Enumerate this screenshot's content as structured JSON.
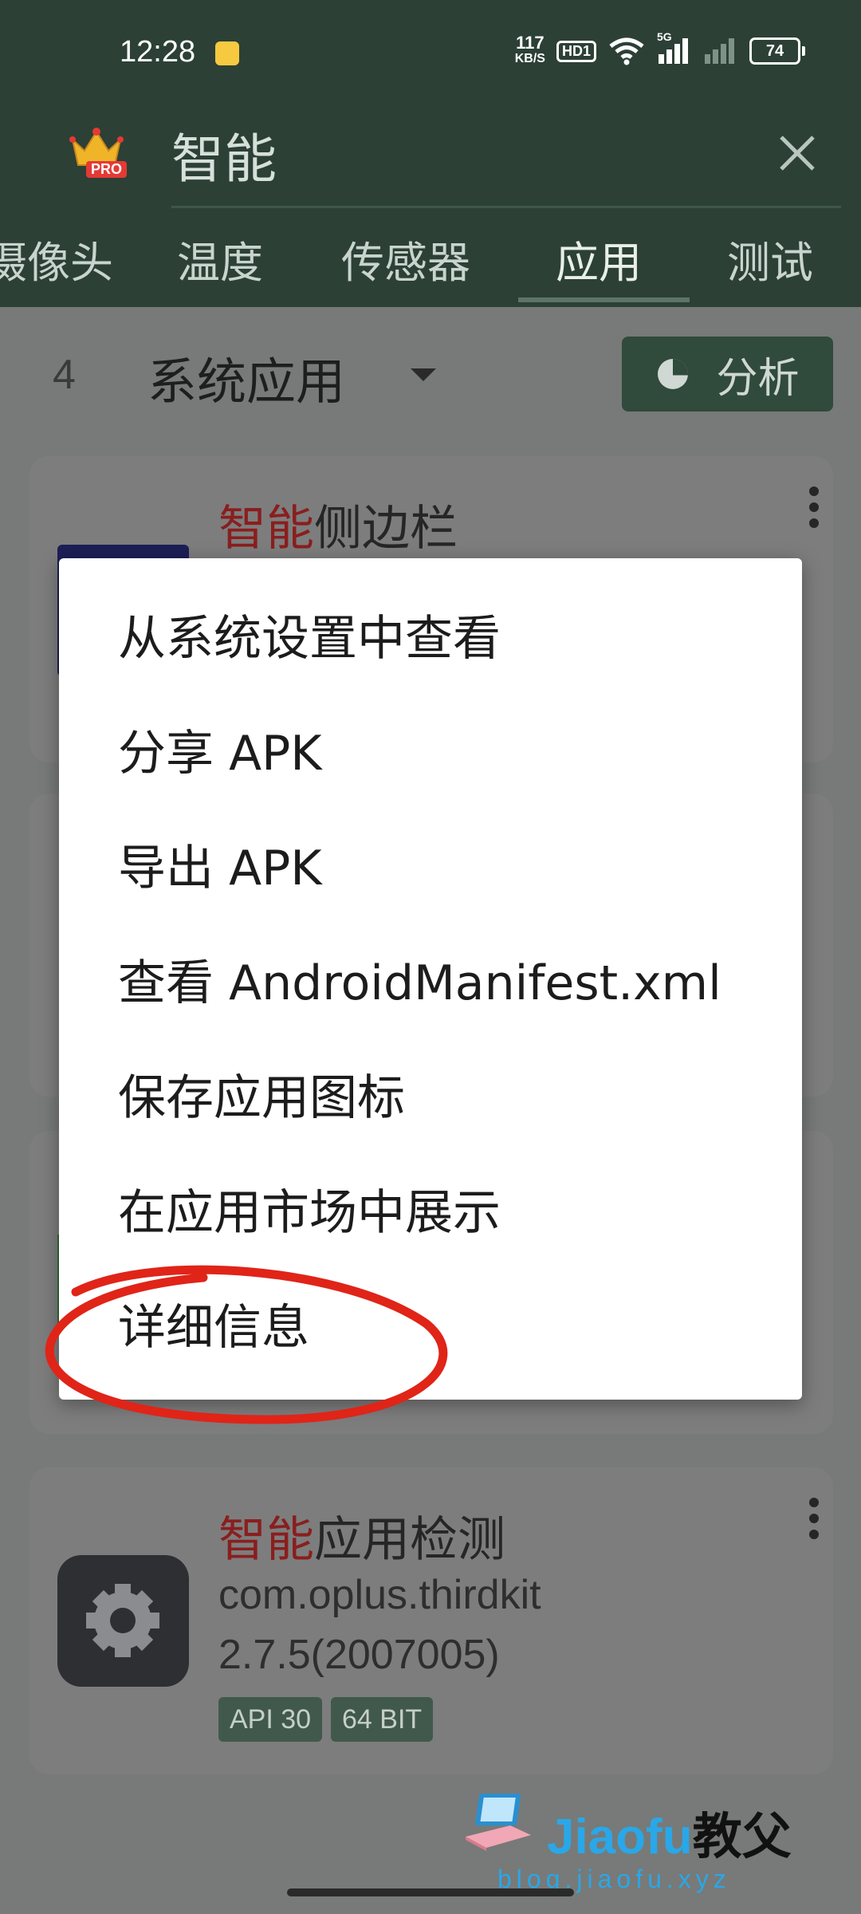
{
  "status_bar": {
    "time": "12:28",
    "net_speed_value": "117",
    "net_speed_unit": "KB/S",
    "hd_label": "HD1",
    "network_label": "5G",
    "battery": "74"
  },
  "app_bar": {
    "search_value": "智能",
    "pro_badge": "PRO"
  },
  "tabs": [
    {
      "label": "摄像头"
    },
    {
      "label": "温度"
    },
    {
      "label": "传感器"
    },
    {
      "label": "应用",
      "active": true
    },
    {
      "label": "测试"
    }
  ],
  "toolbar": {
    "count": "4",
    "filter_selected": "系统应用",
    "analyze_label": "分析"
  },
  "cards": [
    {
      "title_highlight": "智能",
      "title_rest": "侧边栏"
    },
    {
      "title_highlight": "智能",
      "title_rest": "应用检测",
      "package": "com.oplus.thirdkit",
      "version": "2.7.5(2007005)",
      "badges": [
        "API 30",
        "64 BIT"
      ]
    }
  ],
  "menu": {
    "items": [
      "从系统设置中查看",
      "分享 APK",
      "导出 APK",
      "查看 AndroidManifest.xml",
      "保存应用图标",
      "在应用市场中展示",
      "详细信息"
    ],
    "annotation_color": "#e02418"
  },
  "watermark": {
    "brand_en": "Jiaofu",
    "brand_cn": "教父",
    "url": "blog.jiaofu.xyz"
  },
  "colors": {
    "header": "#2c4036",
    "accent_red": "#e02418",
    "watermark_blue": "#2aa7e8"
  }
}
